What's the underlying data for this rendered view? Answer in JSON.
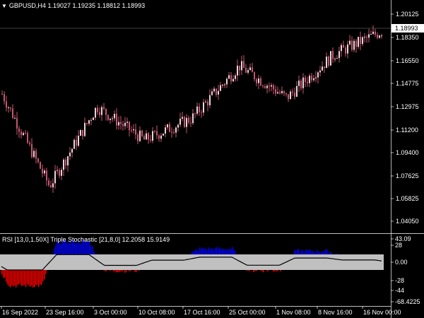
{
  "header": {
    "symbol_label": "GBPUSD,H4",
    "ohlc_label": "1.19027 1.19235 1.18812 1.18993"
  },
  "price_axis": {
    "ticks": [
      "1.20125",
      "1.18350",
      "1.16550",
      "1.14775",
      "1.12975",
      "1.11200",
      "1.09400",
      "1.07625",
      "1.05825",
      "1.04050"
    ],
    "current_price": "1.18993"
  },
  "indicator": {
    "title": "RSI [13,0,1.50X] Triple Stochastic [21,8,0] 12.2058 15.9149",
    "ticks": [
      "43.09",
      "28",
      "0.00",
      "-28",
      "-44",
      "-68.4225"
    ]
  },
  "time_axis": {
    "labels": [
      "16 Sep 2022",
      "23 Sep 16:00",
      "3 Oct 00:00",
      "10 Oct 08:00",
      "17 Oct 16:00",
      "25 Oct 00:00",
      "1 Nov 08:00",
      "8 Nov 16:00",
      "16 Nov 00:00"
    ]
  },
  "colors": {
    "background": "#000000",
    "candle": "#e8d5da",
    "candle_wick": "#c4576f",
    "hist_positive": "#0000ff",
    "hist_negative": "#ff0000",
    "band": "#c0c0c0",
    "signal_line": "#000000",
    "grid_line": "#808080",
    "text": "#ffffff"
  },
  "chart_data": {
    "type": "line",
    "title": "GBPUSD,H4",
    "x": [
      "16 Sep 2022",
      "23 Sep 16:00",
      "3 Oct 00:00",
      "10 Oct 08:00",
      "17 Oct 16:00",
      "25 Oct 00:00",
      "1 Nov 08:00",
      "8 Nov 16:00",
      "16 Nov 00:00"
    ],
    "series": [
      {
        "name": "GBPUSD",
        "values": [
          1.141,
          1.069,
          1.131,
          1.105,
          1.122,
          1.163,
          1.138,
          1.172,
          1.19
        ]
      }
    ],
    "ylim": [
      1.035,
      1.21
    ]
  }
}
